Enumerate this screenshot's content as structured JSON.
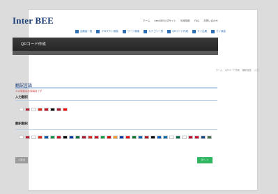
{
  "header": {
    "logo": "Inter BEE",
    "links": [
      "ホーム",
      "InterBEE公式サイト",
      "利用規約",
      "FAQ",
      "お問い合わせ"
    ]
  },
  "nav": {
    "items": [
      "出展者一覧",
      "プロダクト検索",
      "ワード検索",
      "カテゴリー別",
      "QRコード作成",
      "マイ出展",
      "マイ商談"
    ]
  },
  "page": {
    "title": "QRコード作成",
    "breadcrumb": [
      "ホーム",
      "QRコード作成",
      "翻訳言語",
      "入力"
    ]
  },
  "section": {
    "title": "翻訳言語",
    "note": "＊の項目は必須項目です",
    "input_lang_label": "入力翻訳",
    "output_lang_label": "翻訳翻訳"
  },
  "buttons": {
    "back": "＜戻る",
    "next": "次へ ＞"
  },
  "flags_input": [
    {
      "name": "japan",
      "color": "#ffffff"
    },
    {
      "name": "usa",
      "color": "#b22234"
    },
    {
      "name": "korea",
      "color": "#ffffff"
    },
    {
      "name": "china",
      "color": "#de2910"
    },
    {
      "name": "spain",
      "color": "#c60b1e"
    },
    {
      "name": "germany",
      "color": "#000000"
    },
    {
      "name": "thailand",
      "color": "#a51931"
    },
    {
      "name": "taiwan",
      "color": "#fe0000"
    }
  ],
  "flags_output": [
    {
      "name": "japan",
      "color": "#ffffff"
    },
    {
      "name": "usa",
      "color": "#b22234"
    },
    {
      "name": "korea",
      "color": "#ffffff"
    },
    {
      "name": "china",
      "color": "#de2910"
    },
    {
      "name": "france",
      "color": "#0055a4"
    },
    {
      "name": "italy",
      "color": "#009246"
    },
    {
      "name": "spain",
      "color": "#c60b1e"
    },
    {
      "name": "germany",
      "color": "#000000"
    },
    {
      "name": "russia",
      "color": "#0039a6"
    },
    {
      "name": "portugal",
      "color": "#046a38"
    },
    {
      "name": "thailand",
      "color": "#a51931"
    },
    {
      "name": "vietnam",
      "color": "#da251d"
    },
    {
      "name": "indonesia",
      "color": "#ce1126"
    },
    {
      "name": "brazil",
      "color": "#009c3b"
    },
    {
      "name": "malaysia",
      "color": "#cc0001"
    },
    {
      "name": "india",
      "color": "#ff9933"
    },
    {
      "name": "philippines",
      "color": "#0038a8"
    },
    {
      "name": "turkey",
      "color": "#e30a17"
    },
    {
      "name": "uae",
      "color": "#00732f"
    },
    {
      "name": "greece",
      "color": "#0d5eaf"
    },
    {
      "name": "netherlands",
      "color": "#ae1c28"
    },
    {
      "name": "belgium",
      "color": "#000000"
    },
    {
      "name": "ukraine",
      "color": "#0057b7"
    },
    {
      "name": "sweden",
      "color": "#006aa7"
    },
    {
      "name": "poland",
      "color": "#ffffff"
    },
    {
      "name": "mexico",
      "color": "#006847"
    },
    {
      "name": "finland",
      "color": "#ffffff"
    },
    {
      "name": "norway",
      "color": "#ba0c2f"
    },
    {
      "name": "denmark",
      "color": "#c60c30"
    },
    {
      "name": "czech",
      "color": "#11457e"
    },
    {
      "name": "hungary",
      "color": "#436f4d"
    }
  ]
}
